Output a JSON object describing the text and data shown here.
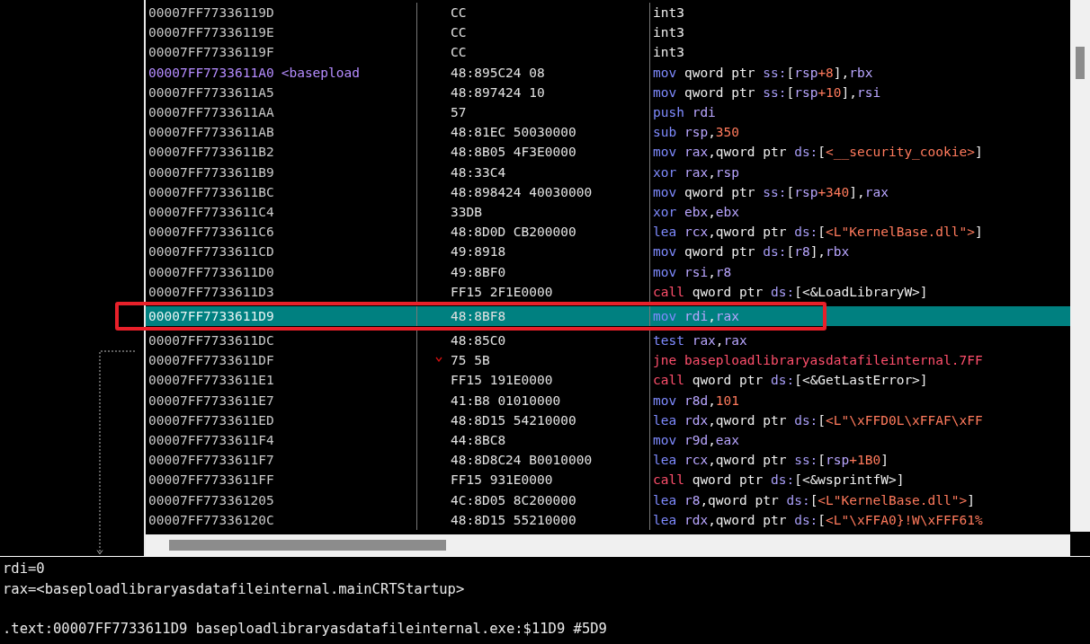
{
  "disassembly": {
    "rows": [
      {
        "address": "00007FF77336119D",
        "bytes": "CC",
        "selected": false,
        "jump": false,
        "boxed": false,
        "instruction": [
          {
            "text": "int3",
            "kind": "plain"
          }
        ]
      },
      {
        "address": "00007FF77336119E",
        "bytes": "CC",
        "selected": false,
        "jump": false,
        "boxed": false,
        "instruction": [
          {
            "text": "int3",
            "kind": "plain"
          }
        ]
      },
      {
        "address": "00007FF77336119F",
        "bytes": "CC",
        "selected": false,
        "jump": false,
        "boxed": false,
        "instruction": [
          {
            "text": "int3",
            "kind": "plain"
          }
        ]
      },
      {
        "address": "00007FF7733611A0",
        "label": "<basepload",
        "bytes": "48:895C24 08",
        "selected": false,
        "jump": false,
        "boxed": false,
        "instruction": [
          {
            "text": "mov ",
            "kind": "mnem"
          },
          {
            "text": "qword ptr ",
            "kind": "plain"
          },
          {
            "text": "ss:",
            "kind": "seg"
          },
          {
            "text": "[",
            "kind": "plain"
          },
          {
            "text": "rsp",
            "kind": "reg"
          },
          {
            "text": "+8",
            "kind": "num"
          },
          {
            "text": "],",
            "kind": "plain"
          },
          {
            "text": "rbx",
            "kind": "reg"
          }
        ]
      },
      {
        "address": "00007FF7733611A5",
        "bytes": "48:897424 10",
        "selected": false,
        "jump": false,
        "boxed": false,
        "instruction": [
          {
            "text": "mov ",
            "kind": "mnem"
          },
          {
            "text": "qword ptr ",
            "kind": "plain"
          },
          {
            "text": "ss:",
            "kind": "seg"
          },
          {
            "text": "[",
            "kind": "plain"
          },
          {
            "text": "rsp",
            "kind": "reg"
          },
          {
            "text": "+10",
            "kind": "num"
          },
          {
            "text": "],",
            "kind": "plain"
          },
          {
            "text": "rsi",
            "kind": "reg"
          }
        ]
      },
      {
        "address": "00007FF7733611AA",
        "bytes": "57",
        "selected": false,
        "jump": false,
        "boxed": false,
        "instruction": [
          {
            "text": "push ",
            "kind": "mnem"
          },
          {
            "text": "rdi",
            "kind": "reg"
          }
        ]
      },
      {
        "address": "00007FF7733611AB",
        "bytes": "48:81EC 50030000",
        "selected": false,
        "jump": false,
        "boxed": false,
        "instruction": [
          {
            "text": "sub ",
            "kind": "mnem"
          },
          {
            "text": "rsp",
            "kind": "reg"
          },
          {
            "text": ",",
            "kind": "plain"
          },
          {
            "text": "350",
            "kind": "num"
          }
        ]
      },
      {
        "address": "00007FF7733611B2",
        "bytes": "48:8B05 4F3E0000",
        "selected": false,
        "jump": false,
        "boxed": false,
        "instruction": [
          {
            "text": "mov ",
            "kind": "mnem"
          },
          {
            "text": "rax",
            "kind": "reg"
          },
          {
            "text": ",qword ptr ",
            "kind": "plain"
          },
          {
            "text": "ds:",
            "kind": "seg"
          },
          {
            "text": "[",
            "kind": "plain"
          },
          {
            "text": "<__security_cookie>",
            "kind": "sym"
          },
          {
            "text": "]",
            "kind": "plain"
          }
        ]
      },
      {
        "address": "00007FF7733611B9",
        "bytes": "48:33C4",
        "selected": false,
        "jump": false,
        "boxed": false,
        "instruction": [
          {
            "text": "xor ",
            "kind": "mnem"
          },
          {
            "text": "rax",
            "kind": "reg"
          },
          {
            "text": ",",
            "kind": "plain"
          },
          {
            "text": "rsp",
            "kind": "reg"
          }
        ]
      },
      {
        "address": "00007FF7733611BC",
        "bytes": "48:898424 40030000",
        "selected": false,
        "jump": false,
        "boxed": false,
        "instruction": [
          {
            "text": "mov ",
            "kind": "mnem"
          },
          {
            "text": "qword ptr ",
            "kind": "plain"
          },
          {
            "text": "ss:",
            "kind": "seg"
          },
          {
            "text": "[",
            "kind": "plain"
          },
          {
            "text": "rsp",
            "kind": "reg"
          },
          {
            "text": "+340",
            "kind": "num"
          },
          {
            "text": "],",
            "kind": "plain"
          },
          {
            "text": "rax",
            "kind": "reg"
          }
        ]
      },
      {
        "address": "00007FF7733611C4",
        "bytes": "33DB",
        "selected": false,
        "jump": false,
        "boxed": false,
        "instruction": [
          {
            "text": "xor ",
            "kind": "mnem"
          },
          {
            "text": "ebx",
            "kind": "reg"
          },
          {
            "text": ",",
            "kind": "plain"
          },
          {
            "text": "ebx",
            "kind": "reg"
          }
        ]
      },
      {
        "address": "00007FF7733611C6",
        "bytes": "48:8D0D CB200000",
        "selected": false,
        "jump": false,
        "boxed": false,
        "instruction": [
          {
            "text": "lea ",
            "kind": "mnem"
          },
          {
            "text": "rcx",
            "kind": "reg"
          },
          {
            "text": ",qword ptr ",
            "kind": "plain"
          },
          {
            "text": "ds:",
            "kind": "seg"
          },
          {
            "text": "[",
            "kind": "plain"
          },
          {
            "text": "<L\"KernelBase.dll\">",
            "kind": "sym"
          },
          {
            "text": "]",
            "kind": "plain"
          }
        ]
      },
      {
        "address": "00007FF7733611CD",
        "bytes": "49:8918",
        "selected": false,
        "jump": false,
        "boxed": false,
        "instruction": [
          {
            "text": "mov ",
            "kind": "mnem"
          },
          {
            "text": "qword ptr ",
            "kind": "plain"
          },
          {
            "text": "ds:",
            "kind": "seg"
          },
          {
            "text": "[",
            "kind": "plain"
          },
          {
            "text": "r8",
            "kind": "reg"
          },
          {
            "text": "],",
            "kind": "plain"
          },
          {
            "text": "rbx",
            "kind": "reg"
          }
        ]
      },
      {
        "address": "00007FF7733611D0",
        "bytes": "49:8BF0",
        "selected": false,
        "jump": false,
        "boxed": false,
        "instruction": [
          {
            "text": "mov ",
            "kind": "mnem"
          },
          {
            "text": "rsi",
            "kind": "reg"
          },
          {
            "text": ",",
            "kind": "plain"
          },
          {
            "text": "r8",
            "kind": "reg"
          }
        ]
      },
      {
        "address": "00007FF7733611D3",
        "bytes": "FF15 2F1E0000",
        "selected": false,
        "jump": false,
        "boxed": false,
        "instruction": [
          {
            "text": "call ",
            "kind": "branch"
          },
          {
            "text": "qword ptr ",
            "kind": "plain"
          },
          {
            "text": "ds:",
            "kind": "seg"
          },
          {
            "text": "[<&LoadLibraryW>]",
            "kind": "plain"
          }
        ]
      },
      {
        "address": "00007FF7733611D9",
        "bytes": "48:8BF8",
        "selected": true,
        "jump": false,
        "boxed": true,
        "instruction": [
          {
            "text": "mov ",
            "kind": "mnem"
          },
          {
            "text": "rdi",
            "kind": "reg"
          },
          {
            "text": ",",
            "kind": "plain"
          },
          {
            "text": "rax",
            "kind": "reg"
          }
        ]
      },
      {
        "address": "00007FF7733611DC",
        "bytes": "48:85C0",
        "selected": false,
        "jump": false,
        "boxed": false,
        "instruction": [
          {
            "text": "test ",
            "kind": "mnem"
          },
          {
            "text": "rax",
            "kind": "reg"
          },
          {
            "text": ",",
            "kind": "plain"
          },
          {
            "text": "rax",
            "kind": "reg"
          }
        ]
      },
      {
        "address": "00007FF7733611DF",
        "bytes": "75 5B",
        "selected": false,
        "jump": true,
        "boxed": false,
        "instruction": [
          {
            "text": "jne ",
            "kind": "branch"
          },
          {
            "text": "baseploadlibraryasdatafileinternal.7FF",
            "kind": "branch"
          }
        ]
      },
      {
        "address": "00007FF7733611E1",
        "bytes": "FF15 191E0000",
        "selected": false,
        "jump": false,
        "boxed": false,
        "instruction": [
          {
            "text": "call ",
            "kind": "branch"
          },
          {
            "text": "qword ptr ",
            "kind": "plain"
          },
          {
            "text": "ds:",
            "kind": "seg"
          },
          {
            "text": "[<&GetLastError>]",
            "kind": "plain"
          }
        ]
      },
      {
        "address": "00007FF7733611E7",
        "bytes": "41:B8 01010000",
        "selected": false,
        "jump": false,
        "boxed": false,
        "instruction": [
          {
            "text": "mov ",
            "kind": "mnem"
          },
          {
            "text": "r8d",
            "kind": "reg"
          },
          {
            "text": ",",
            "kind": "plain"
          },
          {
            "text": "101",
            "kind": "num"
          }
        ]
      },
      {
        "address": "00007FF7733611ED",
        "bytes": "48:8D15 54210000",
        "selected": false,
        "jump": false,
        "boxed": false,
        "instruction": [
          {
            "text": "lea ",
            "kind": "mnem"
          },
          {
            "text": "rdx",
            "kind": "reg"
          },
          {
            "text": ",qword ptr ",
            "kind": "plain"
          },
          {
            "text": "ds:",
            "kind": "seg"
          },
          {
            "text": "[",
            "kind": "plain"
          },
          {
            "text": "<L\"\\xFFD0L\\xFFAF\\xFF",
            "kind": "sym"
          }
        ]
      },
      {
        "address": "00007FF7733611F4",
        "bytes": "44:8BC8",
        "selected": false,
        "jump": false,
        "boxed": false,
        "instruction": [
          {
            "text": "mov ",
            "kind": "mnem"
          },
          {
            "text": "r9d",
            "kind": "reg"
          },
          {
            "text": ",",
            "kind": "plain"
          },
          {
            "text": "eax",
            "kind": "reg"
          }
        ]
      },
      {
        "address": "00007FF7733611F7",
        "bytes": "48:8D8C24 B0010000",
        "selected": false,
        "jump": false,
        "boxed": false,
        "instruction": [
          {
            "text": "lea ",
            "kind": "mnem"
          },
          {
            "text": "rcx",
            "kind": "reg"
          },
          {
            "text": ",qword ptr ",
            "kind": "plain"
          },
          {
            "text": "ss:",
            "kind": "seg"
          },
          {
            "text": "[",
            "kind": "plain"
          },
          {
            "text": "rsp",
            "kind": "reg"
          },
          {
            "text": "+1B0",
            "kind": "num"
          },
          {
            "text": "]",
            "kind": "plain"
          }
        ]
      },
      {
        "address": "00007FF7733611FF",
        "bytes": "FF15 931E0000",
        "selected": false,
        "jump": false,
        "boxed": false,
        "instruction": [
          {
            "text": "call ",
            "kind": "branch"
          },
          {
            "text": "qword ptr ",
            "kind": "plain"
          },
          {
            "text": "ds:",
            "kind": "seg"
          },
          {
            "text": "[<&wsprintfW>]",
            "kind": "plain"
          }
        ]
      },
      {
        "address": "00007FF773361205",
        "bytes": "4C:8D05 8C200000",
        "selected": false,
        "jump": false,
        "boxed": false,
        "instruction": [
          {
            "text": "lea ",
            "kind": "mnem"
          },
          {
            "text": "r8",
            "kind": "reg"
          },
          {
            "text": ",qword ptr ",
            "kind": "plain"
          },
          {
            "text": "ds:",
            "kind": "seg"
          },
          {
            "text": "[",
            "kind": "plain"
          },
          {
            "text": "<L\"KernelBase.dll\">",
            "kind": "sym"
          },
          {
            "text": "]",
            "kind": "plain"
          }
        ]
      },
      {
        "address": "00007FF77336120C",
        "bytes": "48:8D15 55210000",
        "selected": false,
        "jump": false,
        "boxed": false,
        "instruction": [
          {
            "text": "lea ",
            "kind": "mnem"
          },
          {
            "text": "rdx",
            "kind": "reg"
          },
          {
            "text": ",qword ptr ",
            "kind": "plain"
          },
          {
            "text": "ds:",
            "kind": "seg"
          },
          {
            "text": "[",
            "kind": "plain"
          },
          {
            "text": "<L\"\\xFFA0}!W\\xFFF61%",
            "kind": "sym"
          }
        ]
      }
    ]
  },
  "info_pane": {
    "lines": [
      "rdi=0",
      "rax=<baseploadlibraryasdatafileinternal.mainCRTStartup>"
    ],
    "location": ".text:00007FF7733611D9 baseploadlibraryasdatafileinternal.exe:$11D9 #5D9"
  }
}
